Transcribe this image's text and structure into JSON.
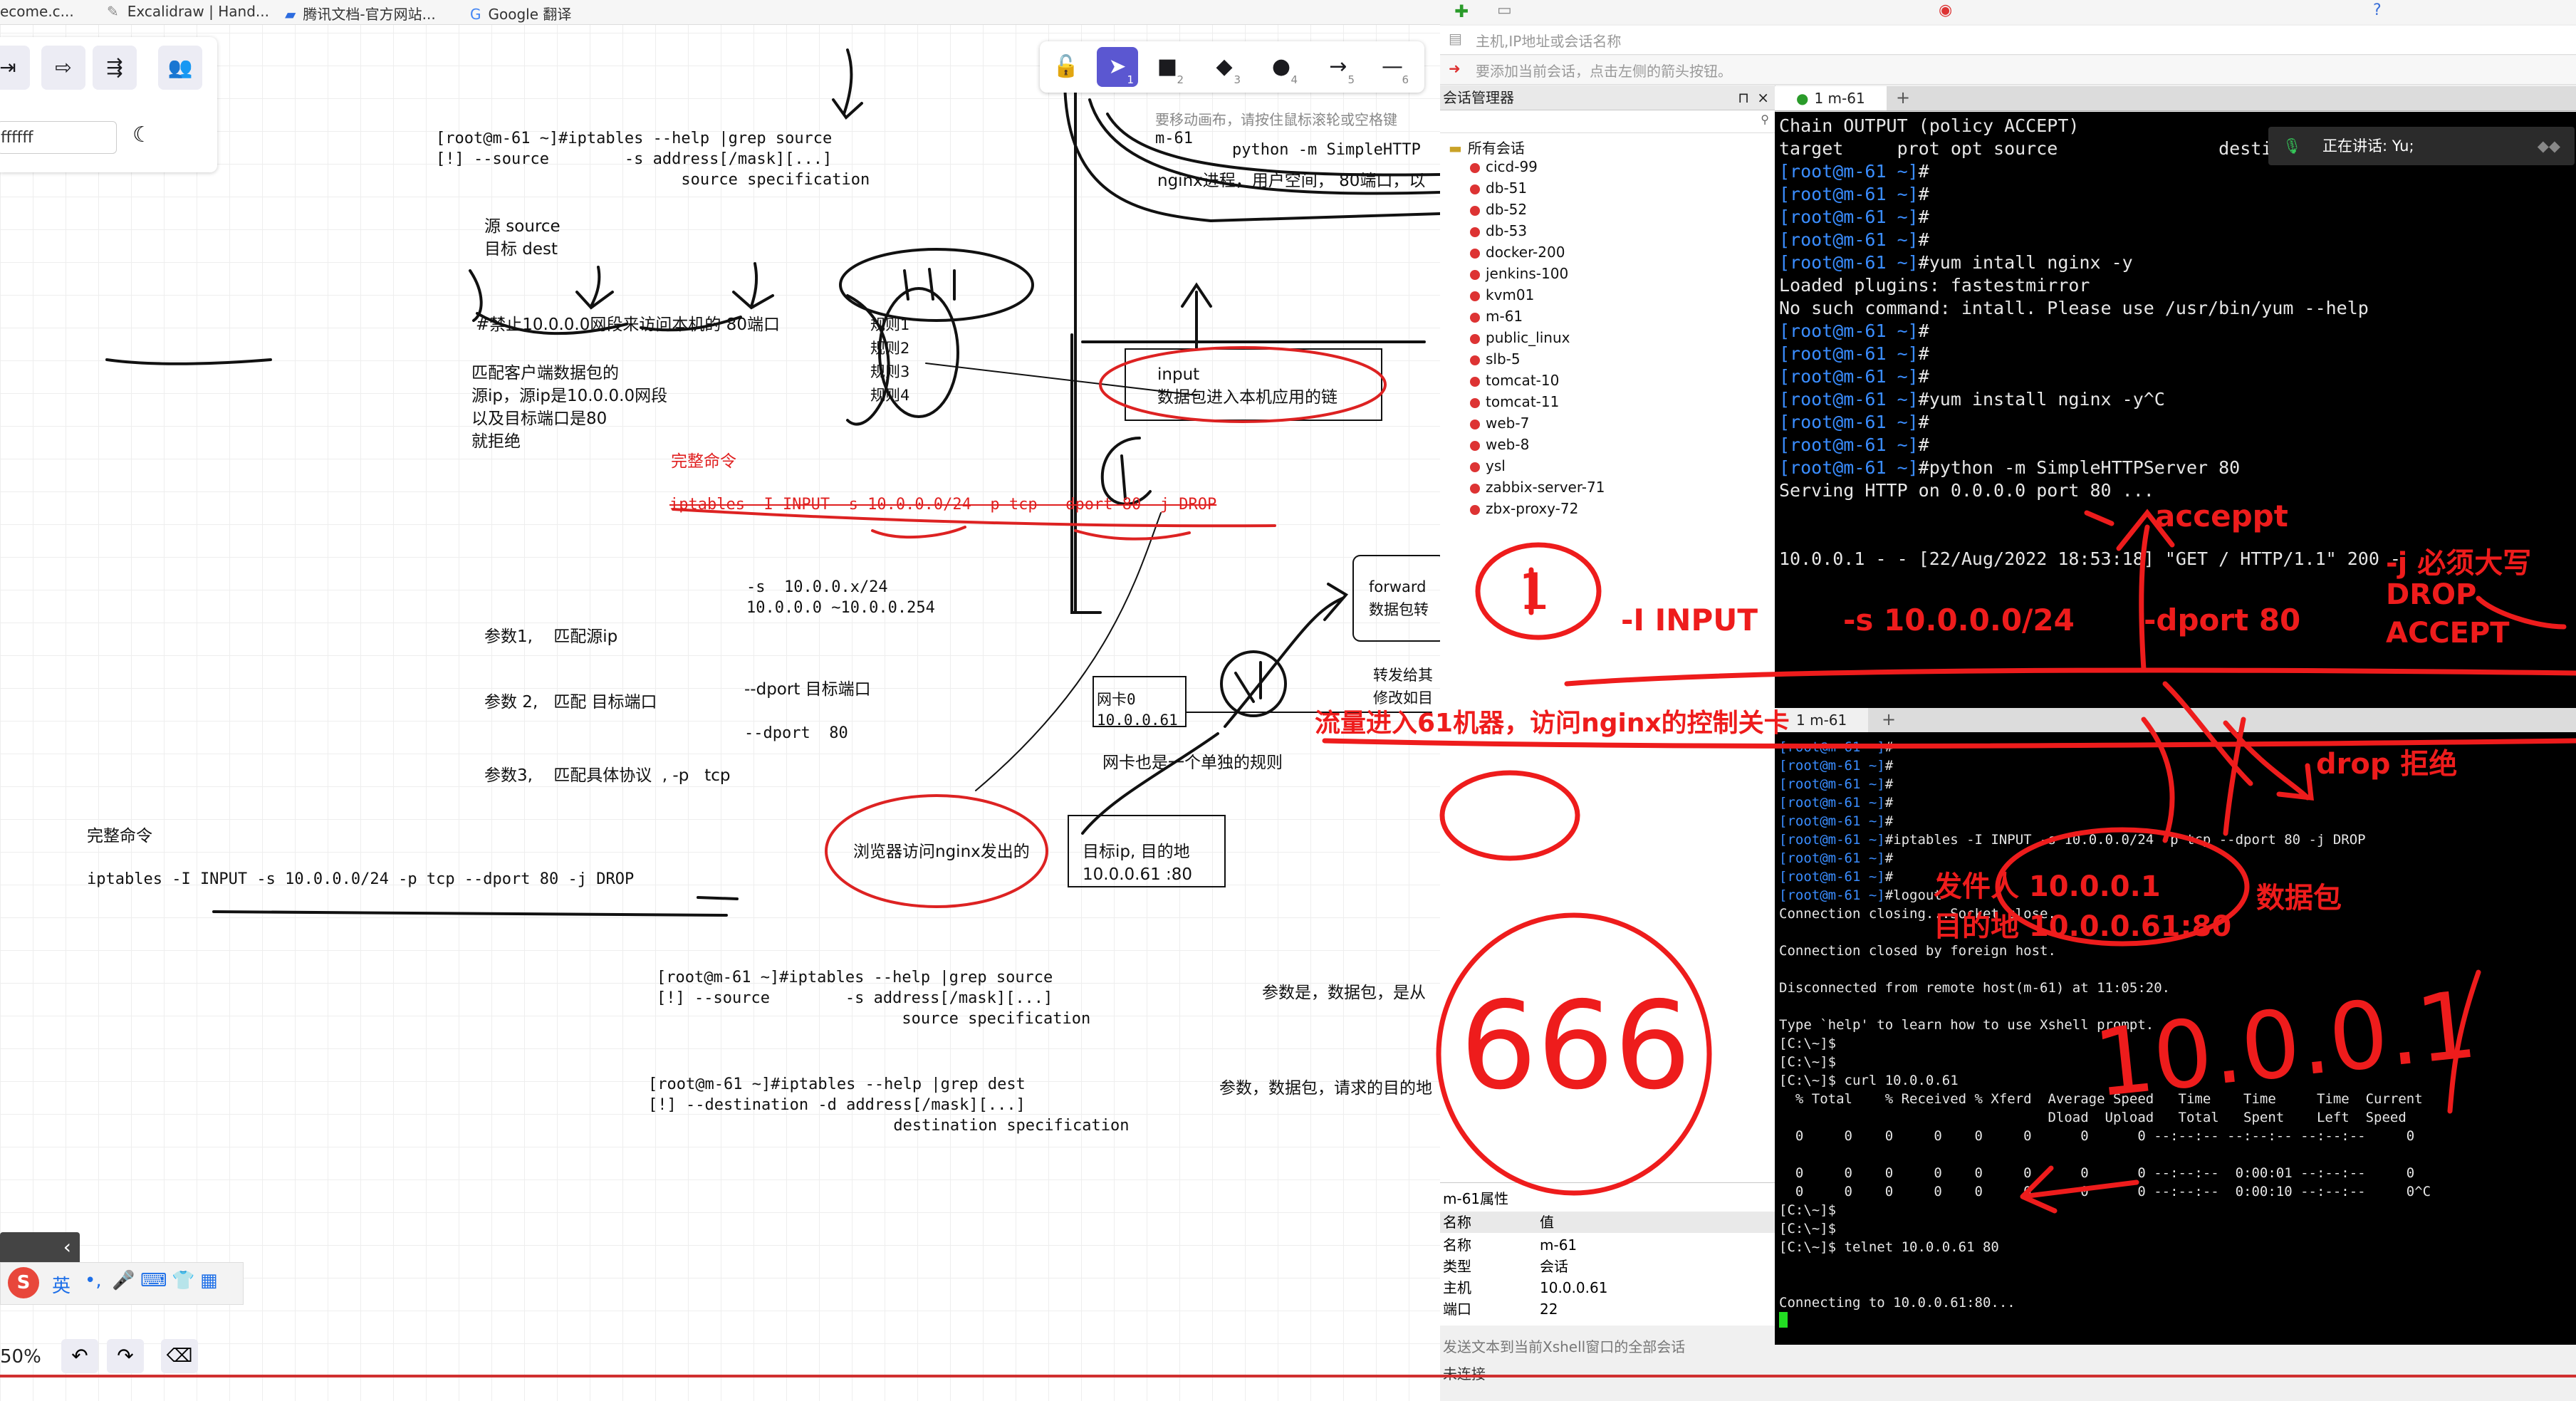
{
  "bookmarks": {
    "b0": "ecome.c...",
    "b1": "Excalidraw | Hand...",
    "b2": "腾讯文档-官方网站...",
    "b3": "Google 翻译"
  },
  "excalidraw": {
    "color_value": "ffffff",
    "zoom": "50%",
    "ime": "英",
    "tool_nums": [
      "1",
      "2",
      "3",
      "4",
      "5",
      "6"
    ],
    "hint": "要移动画布，请按住鼠标滚轮或空格键",
    "texts": {
      "t1": "[root@m-61 ~]#iptables --help |grep source\n[!] --source        -s address[/mask][...]\n                          source specification",
      "t2": "源 source\n目标 dest",
      "t3": "#禁止10.0.0.0网段来访问本机的 80端口",
      "t4": "匹配客户端数据包的\n源ip，源ip是10.0.0.0网段\n以及目标端口是80\n就拒绝",
      "t5": "完整命令",
      "t6": "iptables -I INPUT -s 10.0.0.0/24 -p tcp --dport 80 -j DROP",
      "t7": "-s  10.0.0.x/24\n10.0.0.0 ~10.0.0.254",
      "t8": "参数1,    匹配源ip",
      "t9": "参数 2,   匹配 目标端口",
      "t10": "--dport 目标端口",
      "t11": "--dport  80",
      "t12": "参数3,    匹配具体协议  , -p   tcp",
      "t13": "完整命令",
      "t14": "iptables -I INPUT -s 10.0.0.0/24 -p tcp --dport 80 -j DROP",
      "t15": "规则1\n规则2\n规则3\n规则4",
      "t16": "input\n数据包进入本机应用的链",
      "t17": "m-61",
      "t18": "python -m SimpleHTTP",
      "t19": "nginx进程，用户空间， 80端口，以",
      "t20": "forward\n数据包转",
      "t21": "转发给其\n修改如目",
      "t22": "网卡0\n10.0.0.61",
      "t23": "网卡也是一个单独的规则",
      "t24": "浏览器访问nginx发出的",
      "t25": "目标ip, 目的地\n10.0.0.61 :80",
      "t26": "[root@m-61 ~]#iptables --help |grep source\n[!] --source        -s address[/mask][...]\n                          source specification",
      "t27": "参数是，数据包，是从",
      "t28": "[root@m-61 ~]#iptables --help |grep dest\n[!] --destination -d address[/mask][...]\n                          destination specification",
      "t29": "参数，数据包，请求的目的地"
    }
  },
  "xshell": {
    "host_hint": "主机,IP地址或会话名称",
    "add_hint": "要添加当前会话，点击左侧的箭头按钮。",
    "session_manager": "会话管理器",
    "all_sessions": "所有会话",
    "sessions": [
      "cicd-99",
      "db-51",
      "db-52",
      "db-53",
      "docker-200",
      "jenkins-100",
      "kvm01",
      "m-61",
      "public_linux",
      "slb-5",
      "tomcat-10",
      "tomcat-11",
      "web-7",
      "web-8",
      "ysl",
      "zabbix-server-71",
      "zbx-proxy-72"
    ],
    "tab1": "1 m-61",
    "tab2": "1 m-61",
    "speaking": "正在讲话: Yu;",
    "term1_lines": [
      "Chain OUTPUT (policy ACCEPT)",
      "target     prot opt source               destinat",
      "[root@m-61 ~]#",
      "[root@m-61 ~]#",
      "[root@m-61 ~]#",
      "[root@m-61 ~]#",
      "[root@m-61 ~]#yum intall nginx -y",
      "Loaded plugins: fastestmirror",
      "No such command: intall. Please use /usr/bin/yum --help",
      "[root@m-61 ~]#",
      "[root@m-61 ~]#",
      "[root@m-61 ~]#",
      "[root@m-61 ~]#yum install nginx -y^C",
      "[root@m-61 ~]#",
      "[root@m-61 ~]#",
      "[root@m-61 ~]#python -m SimpleHTTPServer 80",
      "Serving HTTP on 0.0.0.0 port 80 ..."
    ],
    "term1_log": "10.0.0.1 - - [22/Aug/2022 18:53:18] \"GET / HTTP/1.1\" 200 -",
    "term2_lines": [
      "[root@m-61 ~]#",
      "[root@m-61 ~]#",
      "[root@m-61 ~]#",
      "[root@m-61 ~]#",
      "[root@m-61 ~]#",
      "[root@m-61 ~]#iptables -I INPUT -s 10.0.0.0/24 -p tcp --dport 80 -j DROP",
      "[root@m-61 ~]#",
      "[root@m-61 ~]#",
      "[root@m-61 ~]#logout",
      "Connection closing...Socket close.",
      "",
      "Connection closed by foreign host.",
      "",
      "Disconnected from remote host(m-61) at 11:05:20.",
      "",
      "Type `help' to learn how to use Xshell prompt.",
      "[C:\\~]$",
      "[C:\\~]$",
      "[C:\\~]$ curl 10.0.0.61",
      "  % Total    % Received % Xferd  Average Speed   Time    Time     Time  Current",
      "                                 Dload  Upload   Total   Spent    Left  Speed",
      "  0     0    0     0    0     0      0      0 --:--:-- --:--:-- --:--:--     0",
      "",
      "  0     0    0     0    0     0      0      0 --:--:--  0:00:01 --:--:--     0",
      "  0     0    0     0    0     0      0      0 --:--:--  0:00:10 --:--:--     0^C",
      "[C:\\~]$",
      "[C:\\~]$",
      "[C:\\~]$ telnet 10.0.0.61 80",
      "",
      "",
      "Connecting to 10.0.0.61:80..."
    ],
    "props_title": "m-61属性",
    "props_header": {
      "k": "名称",
      "v": "值"
    },
    "props": [
      {
        "k": "名称",
        "v": "m-61"
      },
      {
        "k": "类型",
        "v": "会话"
      },
      {
        "k": "主机",
        "v": "10.0.0.61"
      },
      {
        "k": "端口",
        "v": "22"
      }
    ],
    "status_send": "发送文本到当前Xshell窗口的全部会话",
    "status_conn": "未连接"
  },
  "annotations": {
    "a1": "acceppt",
    "a2": "-j 必须大写",
    "a3": "DROP",
    "a4": "ACCEPT",
    "a5": "-I INPUT",
    "a6": "-s 10.0.0.0/24",
    "a7": "-dport 80",
    "a8": "流量进入61机器，访问nginx的控制关卡",
    "a9": "drop 拒绝",
    "a10": "发件人 10.0.0.1",
    "a11": "目的地  10.0.0.61:80",
    "a12": "数据包",
    "a13": "10.0.0.1",
    "a14": "666",
    "a15": "1"
  },
  "colors": {
    "accent": "#5b57d1",
    "annotation": "#ee1c1c",
    "prompt": "#3a8dff"
  }
}
